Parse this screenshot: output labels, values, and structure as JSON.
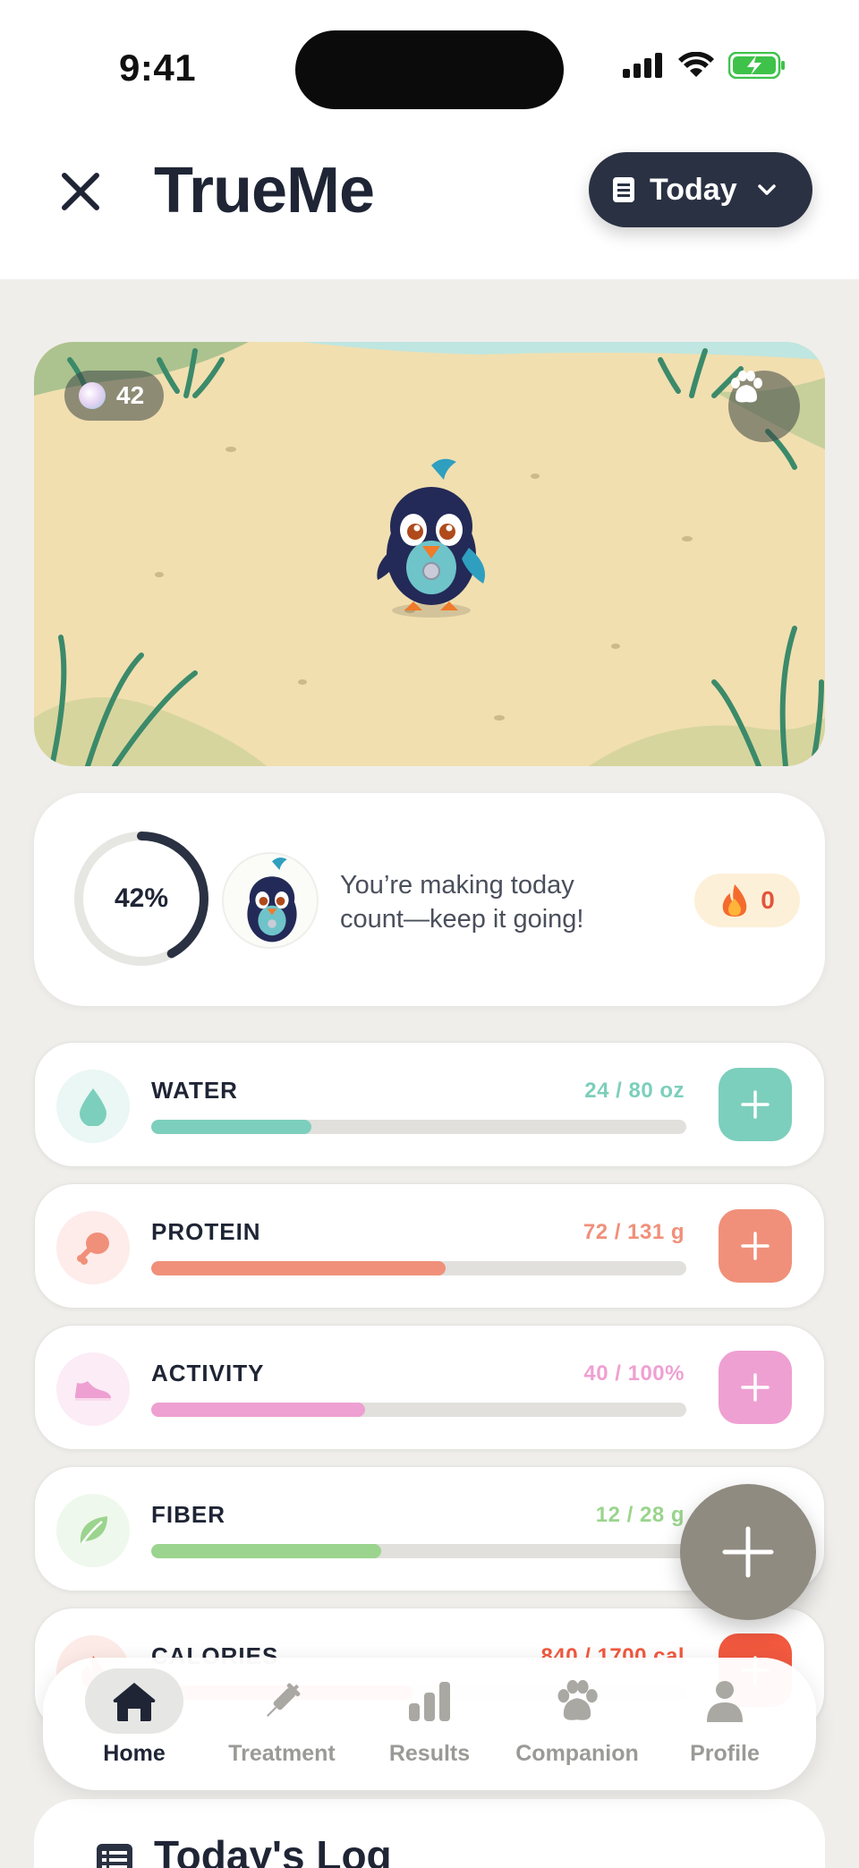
{
  "status_bar": {
    "time": "9:41"
  },
  "header": {
    "title": "TrueMe",
    "date_filter": "Today"
  },
  "companion": {
    "coins": "42"
  },
  "summary": {
    "progress_label": "42%",
    "progress_fraction": 0.42,
    "message": "You’re making today count—keep it going!",
    "streak": "0"
  },
  "trackers": [
    {
      "name": "WATER",
      "value": "24 / 80 oz",
      "progress": 0.3,
      "color": "#7ccfbc",
      "bg": "#eaf7f4",
      "icon": "water-drop-icon"
    },
    {
      "name": "PROTEIN",
      "value": "72 / 131 g",
      "progress": 0.55,
      "color": "#f0907a",
      "bg": "#fdecea",
      "icon": "drumstick-icon"
    },
    {
      "name": "ACTIVITY",
      "value": "40 / 100%",
      "progress": 0.4,
      "color": "#efa0d2",
      "bg": "#fcecf6",
      "icon": "sneaker-icon"
    },
    {
      "name": "FIBER",
      "value": "12 / 28 g",
      "progress": 0.43,
      "color": "#9bd48e",
      "bg": "#eef8ec",
      "icon": "leaf-icon"
    },
    {
      "name": "CALORIES",
      "value": "840 / 1700 cal",
      "progress": 0.49,
      "color": "#f2593f",
      "bg": "#fdebe7",
      "icon": "flame-icon"
    }
  ],
  "tabs": [
    {
      "label": "Home",
      "icon": "home-icon",
      "active": true
    },
    {
      "label": "Treatment",
      "icon": "syringe-icon",
      "active": false
    },
    {
      "label": "Results",
      "icon": "bar-chart-icon",
      "active": false
    },
    {
      "label": "Companion",
      "icon": "paw-icon",
      "active": false
    },
    {
      "label": "Profile",
      "icon": "person-icon",
      "active": false
    }
  ],
  "log": {
    "title": "Today's Log"
  }
}
